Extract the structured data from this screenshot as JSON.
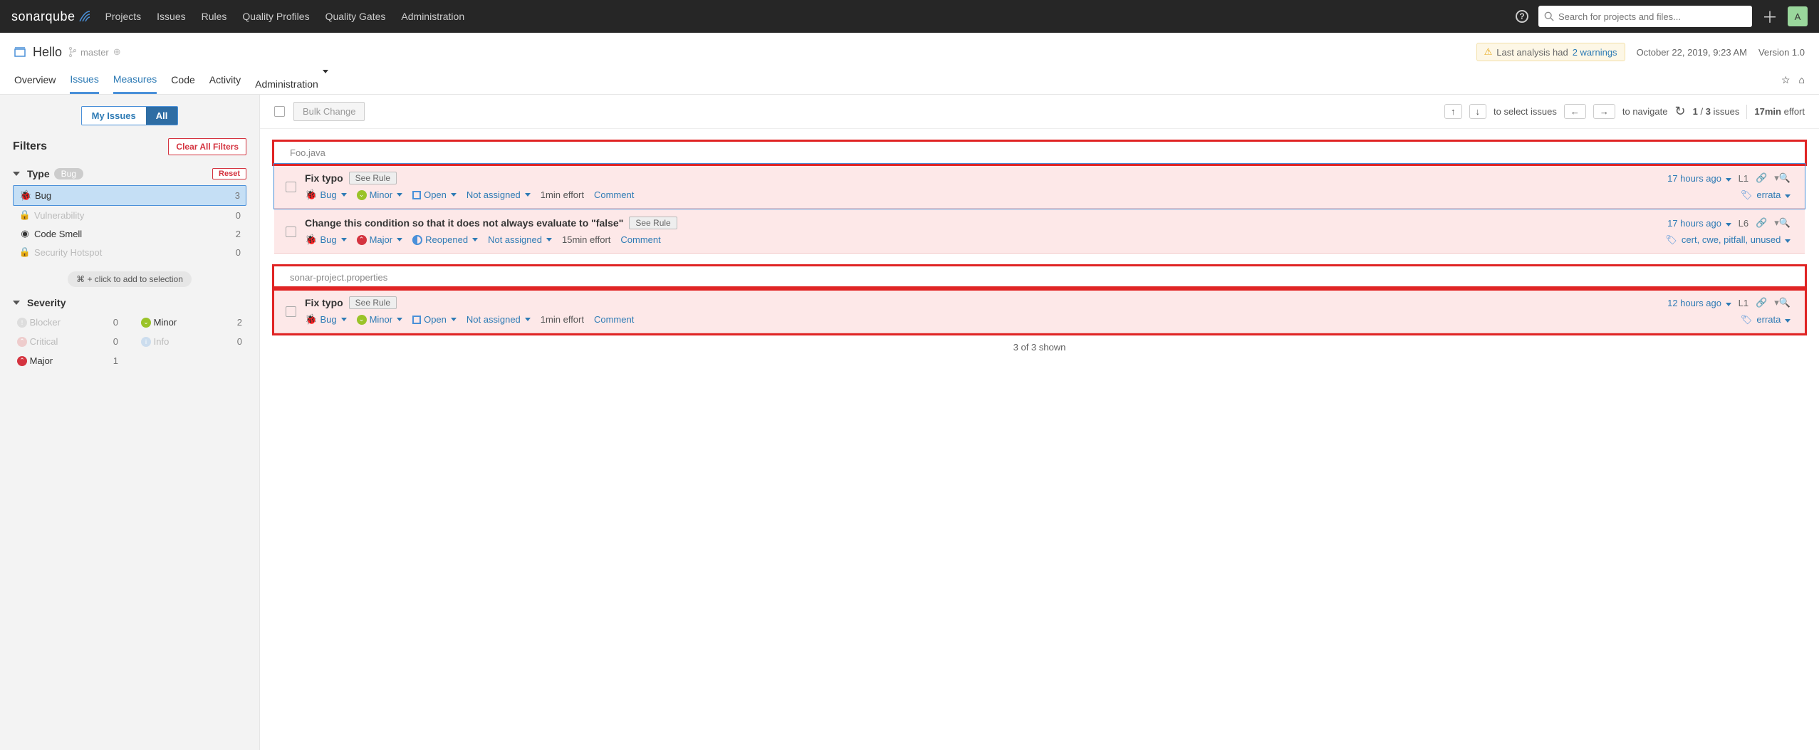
{
  "topnav": {
    "brand": "sonarqube",
    "items": [
      "Projects",
      "Issues",
      "Rules",
      "Quality Profiles",
      "Quality Gates",
      "Administration"
    ],
    "search_placeholder": "Search for projects and files...",
    "avatar_letter": "A"
  },
  "project": {
    "name": "Hello",
    "branch": "master",
    "warning_prefix": "Last analysis had ",
    "warning_link": "2 warnings",
    "analysis_date": "October 22, 2019, 9:23 AM",
    "version": "Version 1.0",
    "tabs": [
      "Overview",
      "Issues",
      "Measures",
      "Code",
      "Activity",
      "Administration"
    ],
    "active_tabs": [
      "Issues",
      "Measures"
    ]
  },
  "sidebar": {
    "toggle": {
      "my": "My Issues",
      "all": "All"
    },
    "filters_label": "Filters",
    "clear_label": "Clear All Filters",
    "reset_label": "Reset",
    "type": {
      "label": "Type",
      "badge": "Bug",
      "items": [
        {
          "name": "Bug",
          "count": "3",
          "selected": true,
          "disabled": false
        },
        {
          "name": "Vulnerability",
          "count": "0",
          "selected": false,
          "disabled": true
        },
        {
          "name": "Code Smell",
          "count": "2",
          "selected": false,
          "disabled": false
        },
        {
          "name": "Security Hotspot",
          "count": "0",
          "selected": false,
          "disabled": true
        }
      ]
    },
    "hint": "⌘ + click to add to selection",
    "severity": {
      "label": "Severity",
      "items": [
        {
          "name": "Blocker",
          "count": "0",
          "color": "c-major",
          "disabled": true
        },
        {
          "name": "Minor",
          "count": "2",
          "color": "c-minor",
          "disabled": false
        },
        {
          "name": "Critical",
          "count": "0",
          "color": "c-major",
          "disabled": true
        },
        {
          "name": "Info",
          "count": "0",
          "color": "c-info",
          "disabled": true
        },
        {
          "name": "Major",
          "count": "1",
          "color": "c-major",
          "disabled": false
        }
      ]
    }
  },
  "toolbar": {
    "bulk": "Bulk Change",
    "select_hint": "to select issues",
    "nav_hint": "to navigate",
    "count_cur": "1",
    "count_sep": "/",
    "count_tot": "3",
    "count_lbl": "issues",
    "effort_val": "17min",
    "effort_lbl": "effort"
  },
  "groups": [
    {
      "file": "Foo.java",
      "boxed": true,
      "issues": [
        {
          "title": "Fix typo",
          "rule_btn": "See Rule",
          "age": "17 hours ago",
          "line": "L1",
          "type": "Bug",
          "severity": "Minor",
          "sev_class": "c-minor",
          "status": "Open",
          "status_class": "c-open",
          "assignee": "Not assigned",
          "effort": "1min effort",
          "comment": "Comment",
          "tags": "errata",
          "selected": true,
          "boxed": true
        },
        {
          "title": "Change this condition so that it does not always evaluate to \"false\"",
          "rule_btn": "See Rule",
          "age": "17 hours ago",
          "line": "L6",
          "type": "Bug",
          "severity": "Major",
          "sev_class": "c-major",
          "status": "Reopened",
          "status_class": "c-reopen",
          "assignee": "Not assigned",
          "effort": "15min effort",
          "comment": "Comment",
          "tags": "cert, cwe, pitfall, unused",
          "selected": false,
          "boxed": false
        }
      ]
    },
    {
      "file": "sonar-project.properties",
      "boxed": true,
      "issues": [
        {
          "title": "Fix typo",
          "rule_btn": "See Rule",
          "age": "12 hours ago",
          "line": "L1",
          "type": "Bug",
          "severity": "Minor",
          "sev_class": "c-minor",
          "status": "Open",
          "status_class": "c-open",
          "assignee": "Not assigned",
          "effort": "1min effort",
          "comment": "Comment",
          "tags": "errata",
          "selected": false,
          "boxed": true
        }
      ]
    }
  ],
  "shown": "3 of 3 shown"
}
